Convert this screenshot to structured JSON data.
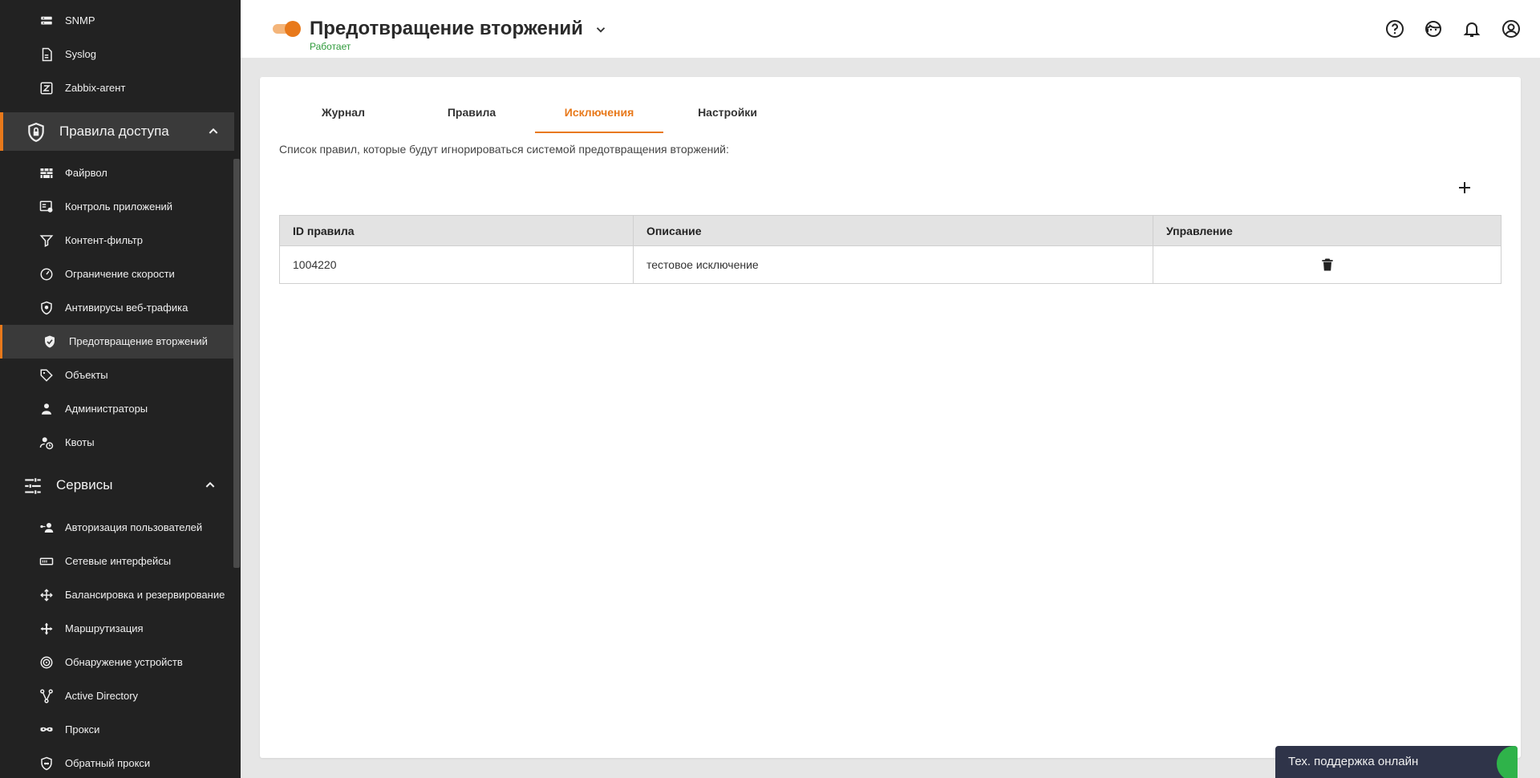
{
  "sidebar": {
    "items_top": [
      {
        "label": "SNMP",
        "icon": "snmp-icon"
      },
      {
        "label": "Syslog",
        "icon": "syslog-icon"
      },
      {
        "label": "Zabbix-агент",
        "icon": "zabbix-icon"
      }
    ],
    "group_access": {
      "label": "Правила доступа",
      "icon": "shield-lock-icon"
    },
    "items_access": [
      {
        "label": "Файрвол",
        "icon": "firewall-icon"
      },
      {
        "label": "Контроль приложений",
        "icon": "app-control-icon"
      },
      {
        "label": "Контент-фильтр",
        "icon": "filter-icon"
      },
      {
        "label": "Ограничение скорости",
        "icon": "speed-limit-icon"
      },
      {
        "label": "Антивирусы веб-трафика",
        "icon": "antivirus-icon"
      },
      {
        "label": "Предотвращение вторжений",
        "icon": "shield-check-icon",
        "active": true
      },
      {
        "label": "Объекты",
        "icon": "tag-icon"
      },
      {
        "label": "Администраторы",
        "icon": "admin-icon"
      },
      {
        "label": "Квоты",
        "icon": "quota-icon"
      }
    ],
    "group_services": {
      "label": "Сервисы",
      "icon": "sliders-icon"
    },
    "items_services": [
      {
        "label": "Авторизация пользователей",
        "icon": "user-auth-icon"
      },
      {
        "label": "Сетевые интерфейсы",
        "icon": "network-interface-icon"
      },
      {
        "label": "Балансировка и резервирование",
        "icon": "balancing-icon"
      },
      {
        "label": "Маршрутизация",
        "icon": "routing-icon"
      },
      {
        "label": "Обнаружение устройств",
        "icon": "discovery-icon"
      },
      {
        "label": "Active Directory",
        "icon": "active-directory-icon"
      },
      {
        "label": "Прокси",
        "icon": "proxy-icon"
      },
      {
        "label": "Обратный прокси",
        "icon": "reverse-proxy-icon"
      }
    ]
  },
  "header": {
    "title": "Предотвращение вторжений",
    "status": "Работает",
    "toggle_on": true,
    "icons": [
      "help-icon",
      "support-agent-icon",
      "bell-icon",
      "account-icon"
    ]
  },
  "tabs": [
    {
      "label": "Журнал",
      "active": false
    },
    {
      "label": "Правила",
      "active": false
    },
    {
      "label": "Исключения",
      "active": true
    },
    {
      "label": "Настройки",
      "active": false
    }
  ],
  "description": "Список правил, которые будут игнорироваться системой предотвращения вторжений:",
  "table": {
    "columns": [
      "ID правила",
      "Описание",
      "Управление"
    ],
    "rows": [
      {
        "id": "1004220",
        "description": "тестовое исключение"
      }
    ]
  },
  "support": {
    "label": "Тех. поддержка онлайн"
  },
  "colors": {
    "accent": "#e8791b",
    "sidebar_bg": "#222222",
    "status_green": "#2e9a3a",
    "support_bg": "#2f3449"
  }
}
